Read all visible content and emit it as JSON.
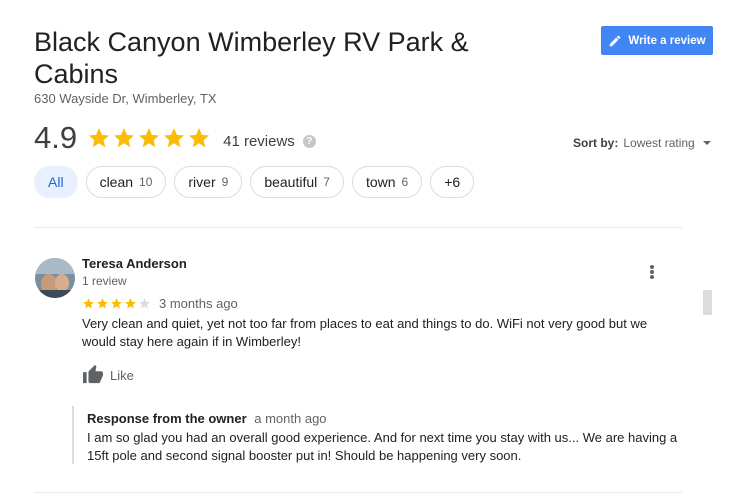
{
  "place": {
    "title": "Black Canyon Wimberley RV Park & Cabins",
    "address": "630 Wayside Dr, Wimberley, TX"
  },
  "write_review": {
    "label": "Write a review",
    "color": "#4285f4"
  },
  "summary": {
    "rating": "4.9",
    "stars": 5,
    "reviews_label": "41 reviews",
    "help_icon": "question-icon",
    "help_glyph": "?"
  },
  "sort": {
    "label": "Sort by:",
    "value": "Lowest rating"
  },
  "filters": [
    {
      "label": "All",
      "count": "",
      "active": true
    },
    {
      "label": "clean",
      "count": "10"
    },
    {
      "label": "river",
      "count": "9"
    },
    {
      "label": "beautiful",
      "count": "7"
    },
    {
      "label": "town",
      "count": "6"
    },
    {
      "label": "+6",
      "count": ""
    }
  ],
  "review": {
    "name": "Teresa Anderson",
    "sub": "1 review",
    "stars": 4,
    "date": "3 months ago",
    "text": "Very clean and quiet, yet not too far from places to eat and things to do. WiFi not very good but we would stay here again if in Wimberley!",
    "like_label": "Like",
    "owner_response": {
      "title": "Response from the owner",
      "date": "a month ago",
      "text": "I am so glad you had an overall good experience. And for next time you stay with us... We are having a 15ft pole and second signal booster put in! Should be happening very soon."
    }
  },
  "colors": {
    "star": "#fbbc04",
    "star_empty": "#dadce0",
    "chip_active_bg": "#e8f0fe",
    "chip_active_text": "#1967d2"
  }
}
